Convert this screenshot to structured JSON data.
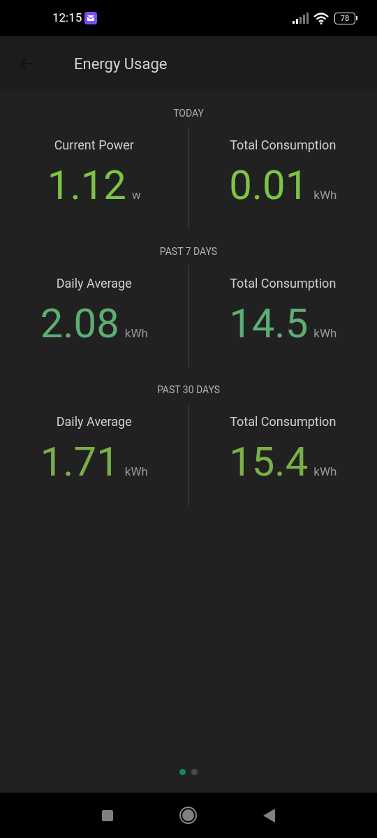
{
  "status_bar": {
    "time": "12:15",
    "battery": "78"
  },
  "app_bar": {
    "title": "Energy Usage"
  },
  "sections": [
    {
      "title": "TODAY",
      "color": "#7cc444",
      "metrics": [
        {
          "label": "Current Power",
          "value": "1.12",
          "unit": "w"
        },
        {
          "label": "Total Consumption",
          "value": "0.01",
          "unit": "kWh"
        }
      ]
    },
    {
      "title": "PAST 7 DAYS",
      "color": "#5dad74",
      "metrics": [
        {
          "label": "Daily Average",
          "value": "2.08",
          "unit": "kWh"
        },
        {
          "label": "Total Consumption",
          "value": "14.5",
          "unit": "kWh"
        }
      ]
    },
    {
      "title": "PAST 30 DAYS",
      "color": "#7aaf48",
      "metrics": [
        {
          "label": "Daily Average",
          "value": "1.71",
          "unit": "kWh"
        },
        {
          "label": "Total Consumption",
          "value": "15.4",
          "unit": "kWh"
        }
      ]
    }
  ],
  "pager": [
    {
      "selected": true
    },
    {
      "selected": false
    }
  ]
}
